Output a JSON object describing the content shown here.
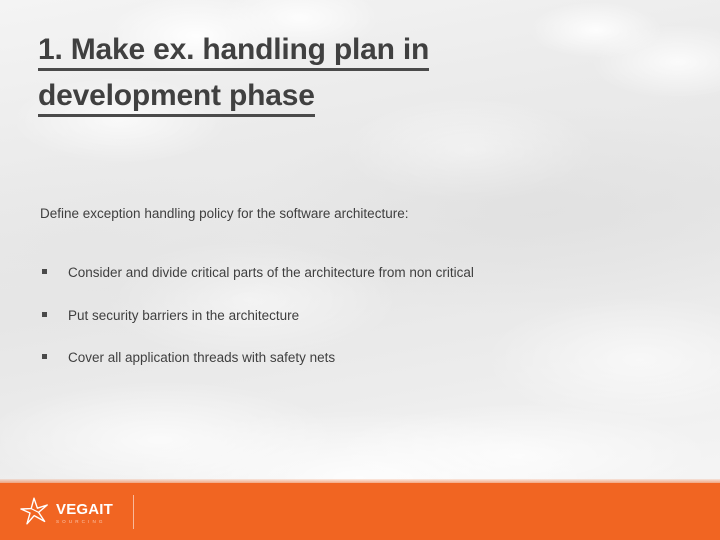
{
  "slide": {
    "title_lines": [
      "1. Make ex. handling plan in",
      "development phase"
    ],
    "title_full": "1. Make ex. handling plan in development phase",
    "lead_paragraph": "Define exception handling policy for the software architecture:",
    "bullets": [
      "Consider and divide critical parts of the architecture from non critical",
      "Put security barriers in the architecture",
      "Cover all application threads with safety nets"
    ]
  },
  "footer": {
    "logo_name": "VEGAIT",
    "logo_sub": "SOURCING",
    "logo_mark_icon": "four-pointed-star-icon",
    "divider_icon": "vertical-divider"
  },
  "colors": {
    "accent_orange": "#f16522",
    "title_text": "#404040",
    "body_text": "#3f3f3f",
    "background_sky": "#ececec",
    "logo_text": "#ffffff"
  }
}
